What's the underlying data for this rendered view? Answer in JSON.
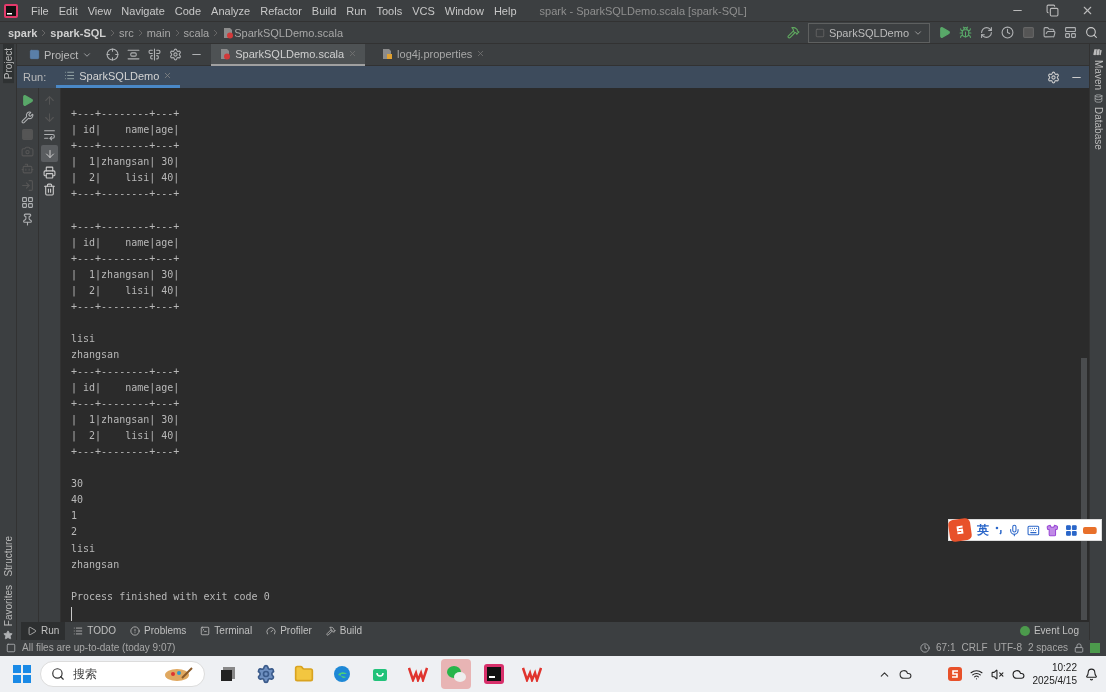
{
  "window": {
    "title": "spark - SparkSQLDemo.scala [spark-SQL]"
  },
  "menu": [
    "File",
    "Edit",
    "View",
    "Navigate",
    "Code",
    "Analyze",
    "Refactor",
    "Build",
    "Run",
    "Tools",
    "VCS",
    "Window",
    "Help"
  ],
  "breadcrumbs": [
    "spark",
    "spark-SQL",
    "src",
    "main",
    "scala",
    "SparkSQLDemo.scala"
  ],
  "run_configuration": "SparkSQLDemo",
  "project_view": "Project",
  "editor_tabs": [
    {
      "label": "SparkSQLDemo.scala",
      "kind": "scala",
      "selected": true
    },
    {
      "label": "log4j.properties",
      "kind": "properties",
      "selected": false
    }
  ],
  "run_panel": {
    "label": "Run:",
    "tabs": [
      {
        "label": "SparkSQLDemo",
        "selected": true
      }
    ]
  },
  "console_blocks": [
    [
      "+---+--------+---+",
      "| id|    name|age|",
      "+---+--------+---+",
      "|  1|zhangsan| 30|",
      "|  2|    lisi| 40|",
      "+---+--------+---+"
    ],
    [
      "+---+--------+---+",
      "| id|    name|age|",
      "+---+--------+---+",
      "|  1|zhangsan| 30|",
      "|  2|    lisi| 40|",
      "+---+--------+---+"
    ],
    [
      "lisi",
      "zhangsan",
      "+---+--------+---+",
      "| id|    name|age|",
      "+---+--------+---+",
      "|  1|zhangsan| 30|",
      "|  2|    lisi| 40|",
      "+---+--------+---+"
    ],
    [
      "30",
      "40",
      "1",
      "2",
      "lisi",
      "zhangsan"
    ],
    [
      "Process finished with exit code 0"
    ]
  ],
  "left_strip": {
    "top": [
      {
        "label": "Project",
        "selected": true
      }
    ],
    "bottom": [
      {
        "label": "Structure",
        "selected": false
      },
      {
        "label": "Favorites",
        "selected": false
      }
    ]
  },
  "right_strip": [
    "Maven",
    "Database"
  ],
  "bottom_tabs": [
    {
      "label": "Run",
      "kind": "run",
      "selected": true
    },
    {
      "label": "TODO",
      "kind": "todo",
      "selected": false
    },
    {
      "label": "Problems",
      "kind": "problems",
      "selected": false
    },
    {
      "label": "Terminal",
      "kind": "terminal",
      "selected": false
    },
    {
      "label": "Profiler",
      "kind": "profiler",
      "selected": false
    },
    {
      "label": "Build",
      "kind": "build",
      "selected": false
    }
  ],
  "event_log": "Event Log",
  "status_bar": {
    "message": "All files are up-to-date (today 9:07)",
    "items": [
      "67:1",
      "CRLF",
      "UTF-8",
      "2 spaces"
    ]
  },
  "ime_toolbar": {
    "mode": "英"
  },
  "taskbar": {
    "search_placeholder": "搜索",
    "apps": [
      {
        "kind": "taskview",
        "selected": false
      },
      {
        "kind": "settings",
        "selected": false
      },
      {
        "kind": "explorer",
        "selected": false
      },
      {
        "kind": "edge",
        "selected": false
      },
      {
        "kind": "store",
        "selected": false
      },
      {
        "kind": "wps",
        "selected": false
      },
      {
        "kind": "chat",
        "selected": true
      },
      {
        "kind": "ide",
        "selected": false
      },
      {
        "kind": "wps",
        "selected": false
      }
    ],
    "time": "10:22",
    "date": "2025/4/15"
  }
}
